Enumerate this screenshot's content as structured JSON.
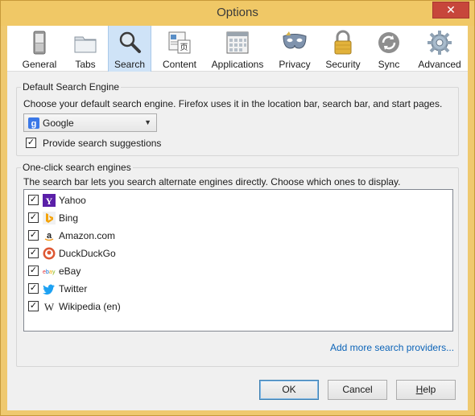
{
  "window": {
    "title": "Options",
    "close_glyph": "✕"
  },
  "toolbar": {
    "items": [
      {
        "label": "General",
        "icon": "switch-icon",
        "active": false
      },
      {
        "label": "Tabs",
        "icon": "tabs-folder-icon",
        "active": false
      },
      {
        "label": "Search",
        "icon": "magnifier-icon",
        "active": true
      },
      {
        "label": "Content",
        "icon": "content-page-icon",
        "active": false
      },
      {
        "label": "Applications",
        "icon": "applications-window-icon",
        "active": false
      },
      {
        "label": "Privacy",
        "icon": "mask-icon",
        "active": false
      },
      {
        "label": "Security",
        "icon": "padlock-icon",
        "active": false
      },
      {
        "label": "Sync",
        "icon": "sync-arrows-icon",
        "active": false
      },
      {
        "label": "Advanced",
        "icon": "gear-icon",
        "active": false
      }
    ]
  },
  "default_engine": {
    "legend": "Default Search Engine",
    "description": "Choose your default search engine. Firefox uses it in the location bar, search bar, and start pages.",
    "selected": "Google",
    "suggestions_label": "Provide search suggestions",
    "suggestions_checked": true
  },
  "one_click": {
    "legend": "One-click search engines",
    "description": "The search bar lets you search alternate engines directly. Choose which ones to display.",
    "engines": [
      {
        "name": "Yahoo",
        "icon": "yahoo-icon",
        "checked": true
      },
      {
        "name": "Bing",
        "icon": "bing-icon",
        "checked": true
      },
      {
        "name": "Amazon.com",
        "icon": "amazon-icon",
        "checked": true
      },
      {
        "name": "DuckDuckGo",
        "icon": "duckduckgo-icon",
        "checked": true
      },
      {
        "name": "eBay",
        "icon": "ebay-icon",
        "checked": true
      },
      {
        "name": "Twitter",
        "icon": "twitter-icon",
        "checked": true
      },
      {
        "name": "Wikipedia (en)",
        "icon": "wikipedia-icon",
        "checked": true
      }
    ],
    "add_more_link": "Add more search providers..."
  },
  "buttons": {
    "ok": "OK",
    "cancel": "Cancel",
    "help_prefix": "H",
    "help_rest": "elp"
  },
  "colors": {
    "titlebar": "#f0c866",
    "link": "#0c64b8",
    "active_tab": "#cfe3f7"
  }
}
